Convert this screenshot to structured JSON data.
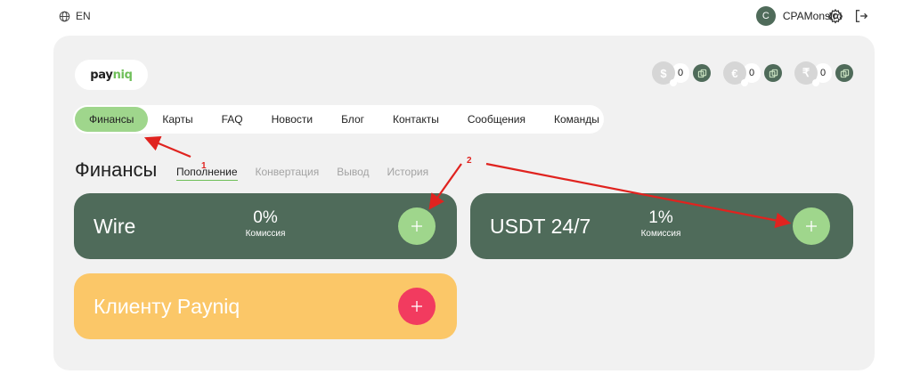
{
  "topbar": {
    "language": "EN",
    "user_initial": "C",
    "username": "CPAMonstro"
  },
  "logo": {
    "part1": "pay",
    "part2": "niq"
  },
  "balances": [
    {
      "currency_symbol": "$",
      "value": "0"
    },
    {
      "currency_symbol": "€",
      "value": "0"
    },
    {
      "currency_symbol": "₹",
      "value": "0"
    }
  ],
  "nav": [
    {
      "label": "Финансы",
      "active": true
    },
    {
      "label": "Карты"
    },
    {
      "label": "FAQ"
    },
    {
      "label": "Новости"
    },
    {
      "label": "Блог"
    },
    {
      "label": "Контакты"
    },
    {
      "label": "Сообщения"
    },
    {
      "label": "Команды"
    }
  ],
  "page": {
    "title": "Финансы",
    "subtabs": [
      {
        "label": "Пополнение",
        "active": true
      },
      {
        "label": "Конвертация"
      },
      {
        "label": "Вывод"
      },
      {
        "label": "История"
      }
    ]
  },
  "cards": [
    {
      "name": "Wire",
      "fee": "0%",
      "fee_label": "Комиссия"
    },
    {
      "name": "USDT 24/7",
      "fee": "1%",
      "fee_label": "Комиссия"
    },
    {
      "name": "Клиенту Payniq"
    }
  ],
  "annotations": [
    "1",
    "2"
  ],
  "colors": {
    "card_dark": "#4f6b5a",
    "card_yellow": "#fbc768",
    "accent_green": "#9fd68c",
    "plus_red": "#f23b5f",
    "arrow_red": "#e0231f"
  },
  "icons": {
    "language": "globe-icon",
    "settings": "gear-icon",
    "logout": "logout-icon",
    "copy": "copy-icon",
    "add": "plus-icon"
  }
}
